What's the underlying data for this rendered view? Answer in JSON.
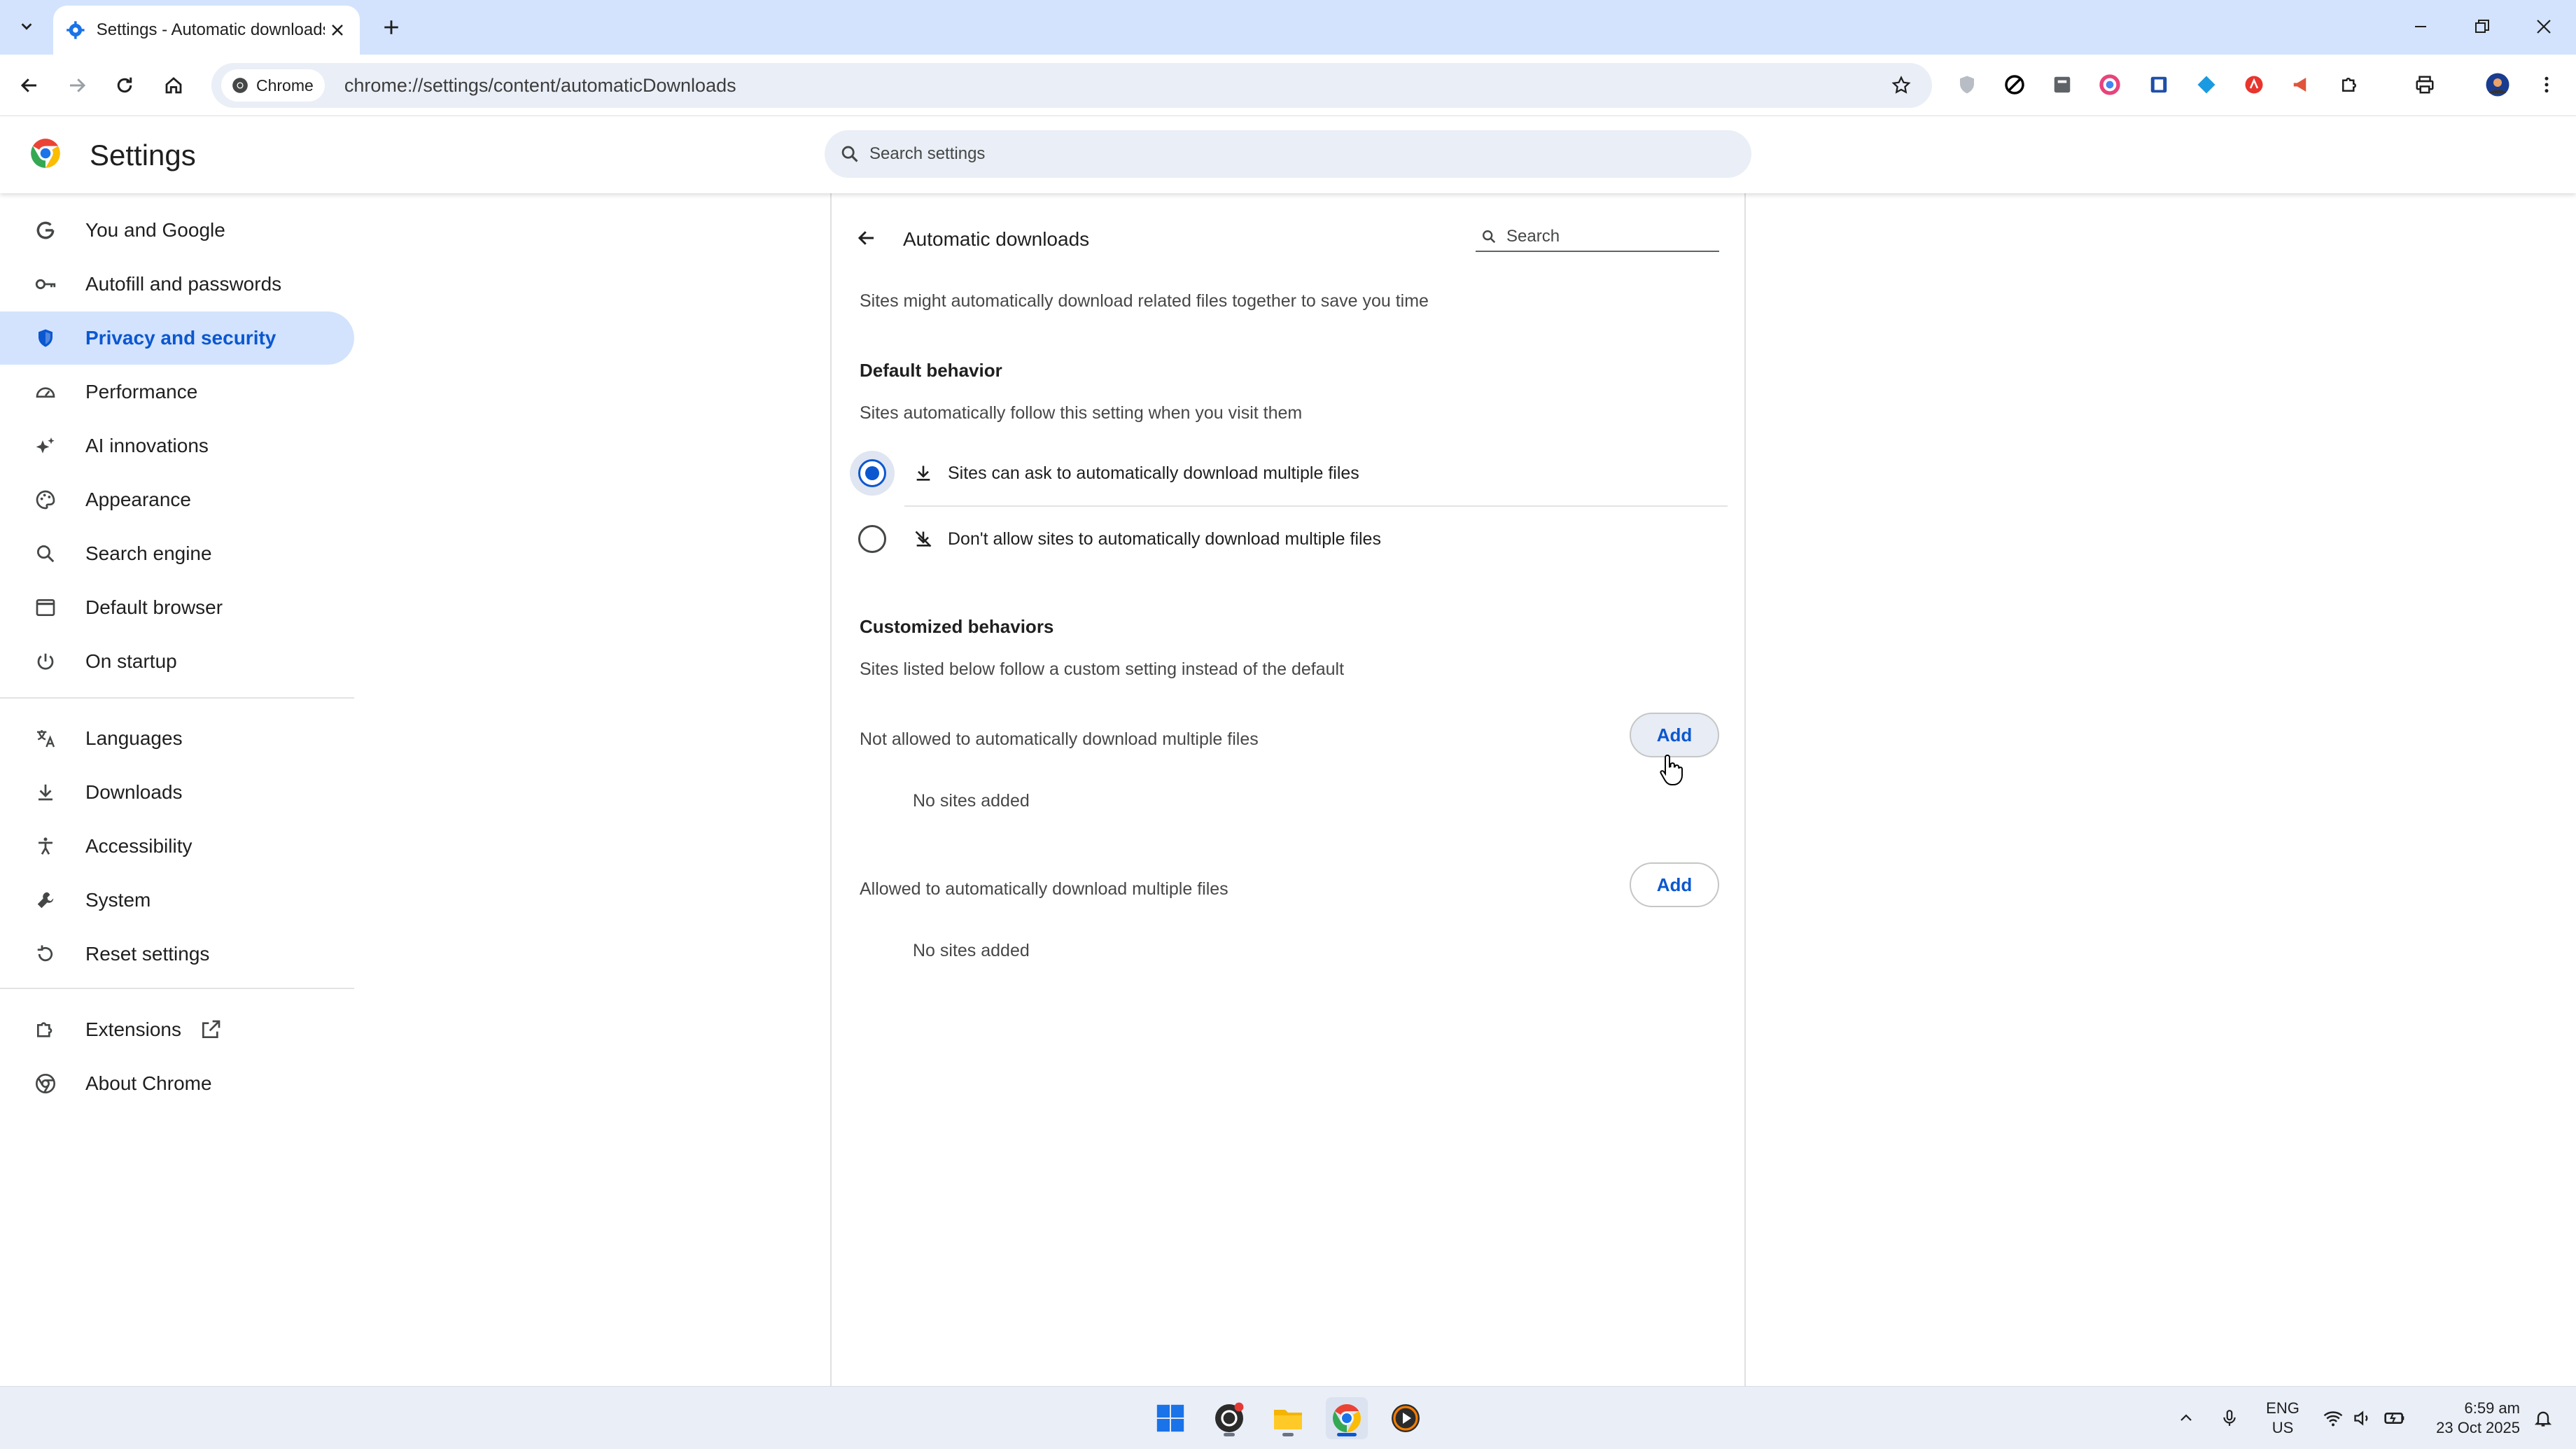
{
  "browser": {
    "tab": {
      "title": "Settings - Automatic downloads"
    },
    "omnibox": {
      "chip_label": "Chrome",
      "url": "chrome://settings/content/automaticDownloads"
    }
  },
  "settings_header": {
    "title": "Settings",
    "search_placeholder": "Search settings"
  },
  "sidebar": {
    "items": [
      {
        "label": "You and Google",
        "icon": "google-g-icon"
      },
      {
        "label": "Autofill and passwords",
        "icon": "key-icon"
      },
      {
        "label": "Privacy and security",
        "icon": "shield-icon",
        "active": true
      },
      {
        "label": "Performance",
        "icon": "speedometer-icon"
      },
      {
        "label": "AI innovations",
        "icon": "sparkle-icon"
      },
      {
        "label": "Appearance",
        "icon": "palette-icon"
      },
      {
        "label": "Search engine",
        "icon": "search-icon"
      },
      {
        "label": "Default browser",
        "icon": "browser-window-icon"
      },
      {
        "label": "On startup",
        "icon": "power-icon"
      },
      {
        "label": "Languages",
        "icon": "translate-icon"
      },
      {
        "label": "Downloads",
        "icon": "download-icon"
      },
      {
        "label": "Accessibility",
        "icon": "accessibility-icon"
      },
      {
        "label": "System",
        "icon": "wrench-icon"
      },
      {
        "label": "Reset settings",
        "icon": "reset-icon"
      },
      {
        "label": "Extensions",
        "icon": "puzzle-icon"
      },
      {
        "label": "About Chrome",
        "icon": "chrome-icon"
      }
    ]
  },
  "page": {
    "title": "Automatic downloads",
    "search_placeholder": "Search",
    "description": "Sites might automatically download related files together to save you time",
    "default_behavior": {
      "heading": "Default behavior",
      "subtext": "Sites automatically follow this setting when you visit them",
      "options": [
        {
          "label": "Sites can ask to automatically download multiple files",
          "checked": true
        },
        {
          "label": "Don't allow sites to automatically download multiple files",
          "checked": false
        }
      ]
    },
    "customized": {
      "heading": "Customized behaviors",
      "subtext": "Sites listed below follow a custom setting instead of the default",
      "not_allowed": {
        "label": "Not allowed to automatically download multiple files",
        "button": "Add",
        "empty": "No sites added"
      },
      "allowed": {
        "label": "Allowed to automatically download multiple files",
        "button": "Add",
        "empty": "No sites added"
      }
    }
  },
  "taskbar": {
    "lang_top": "ENG",
    "lang_bottom": "US",
    "time": "6:59 am",
    "date": "23 Oct 2025"
  },
  "colors": {
    "accent": "#0b57d0",
    "active_nav_bg": "#d3e3fd",
    "tabstrip": "#d3e3fd"
  }
}
